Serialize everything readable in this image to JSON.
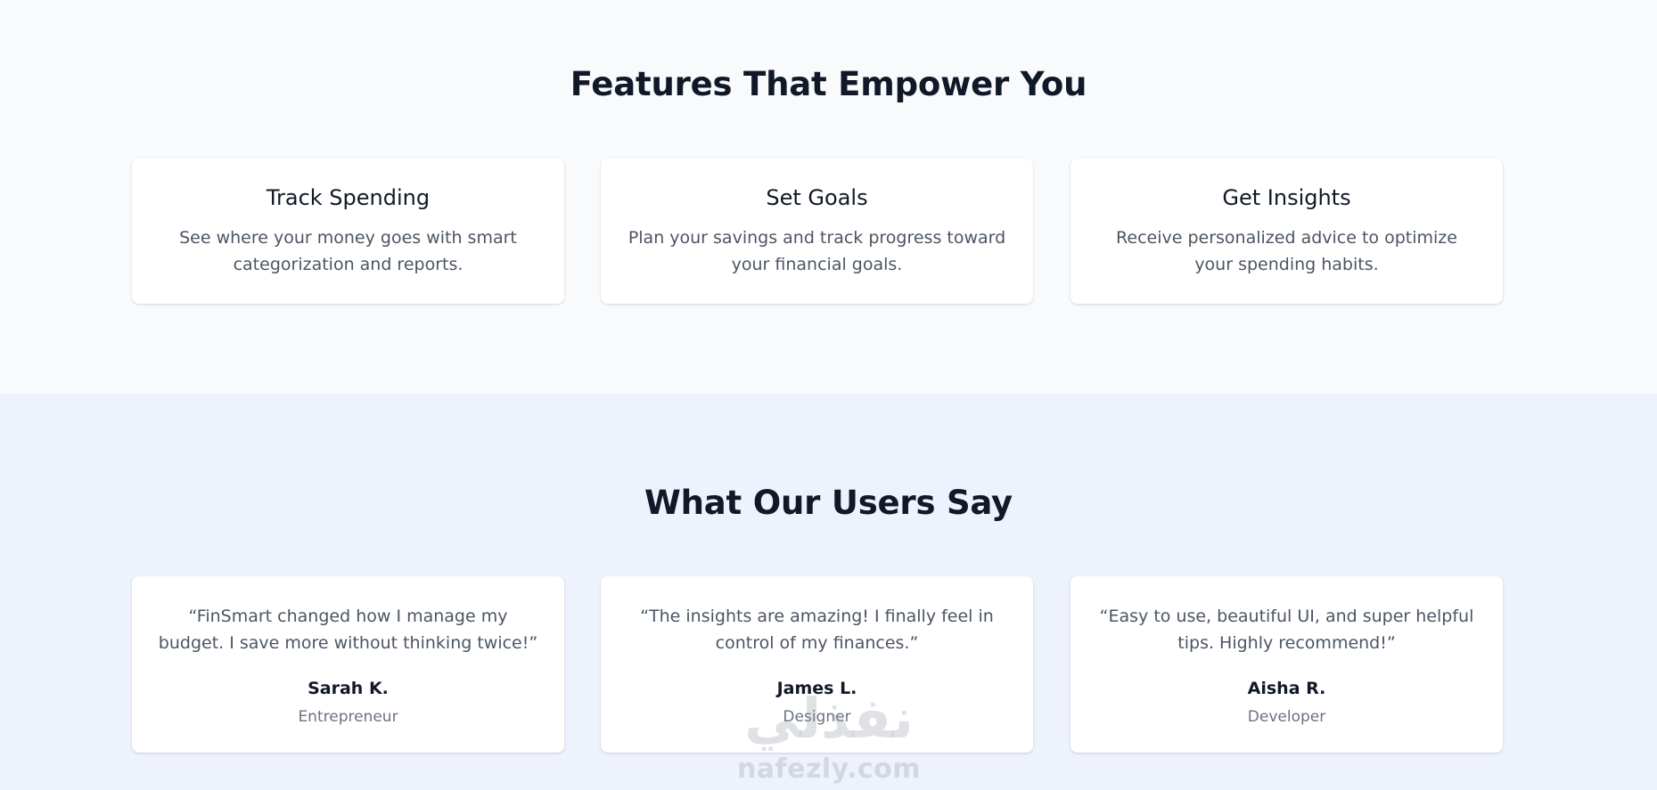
{
  "features": {
    "title": "Features That Empower You",
    "cards": [
      {
        "title": "Track Spending",
        "description": "See where your money goes with smart categorization and reports."
      },
      {
        "title": "Set Goals",
        "description": "Plan your savings and track progress toward your financial goals."
      },
      {
        "title": "Get Insights",
        "description": "Receive personalized advice to optimize your spending habits."
      }
    ]
  },
  "testimonials": {
    "title": "What Our Users Say",
    "cards": [
      {
        "quote": "“FinSmart changed how I manage my budget. I save more without thinking twice!”",
        "name": "Sarah K.",
        "role": "Entrepreneur"
      },
      {
        "quote": "“The insights are amazing! I finally feel in control of my finances.”",
        "name": "James L.",
        "role": "Designer"
      },
      {
        "quote": "“Easy to use, beautiful UI, and super helpful tips. Highly recommend!”",
        "name": "Aisha R.",
        "role": "Developer"
      }
    ]
  },
  "watermark": {
    "logo_text": "نفذلي",
    "url_text": "nafezly.com"
  },
  "colors": {
    "features_background": "#f8fafc",
    "testimonials_background": "#eef2fd",
    "heading": "#111827",
    "body_text": "#4b5563",
    "muted_text": "#6b7280",
    "card_background": "#ffffff"
  }
}
